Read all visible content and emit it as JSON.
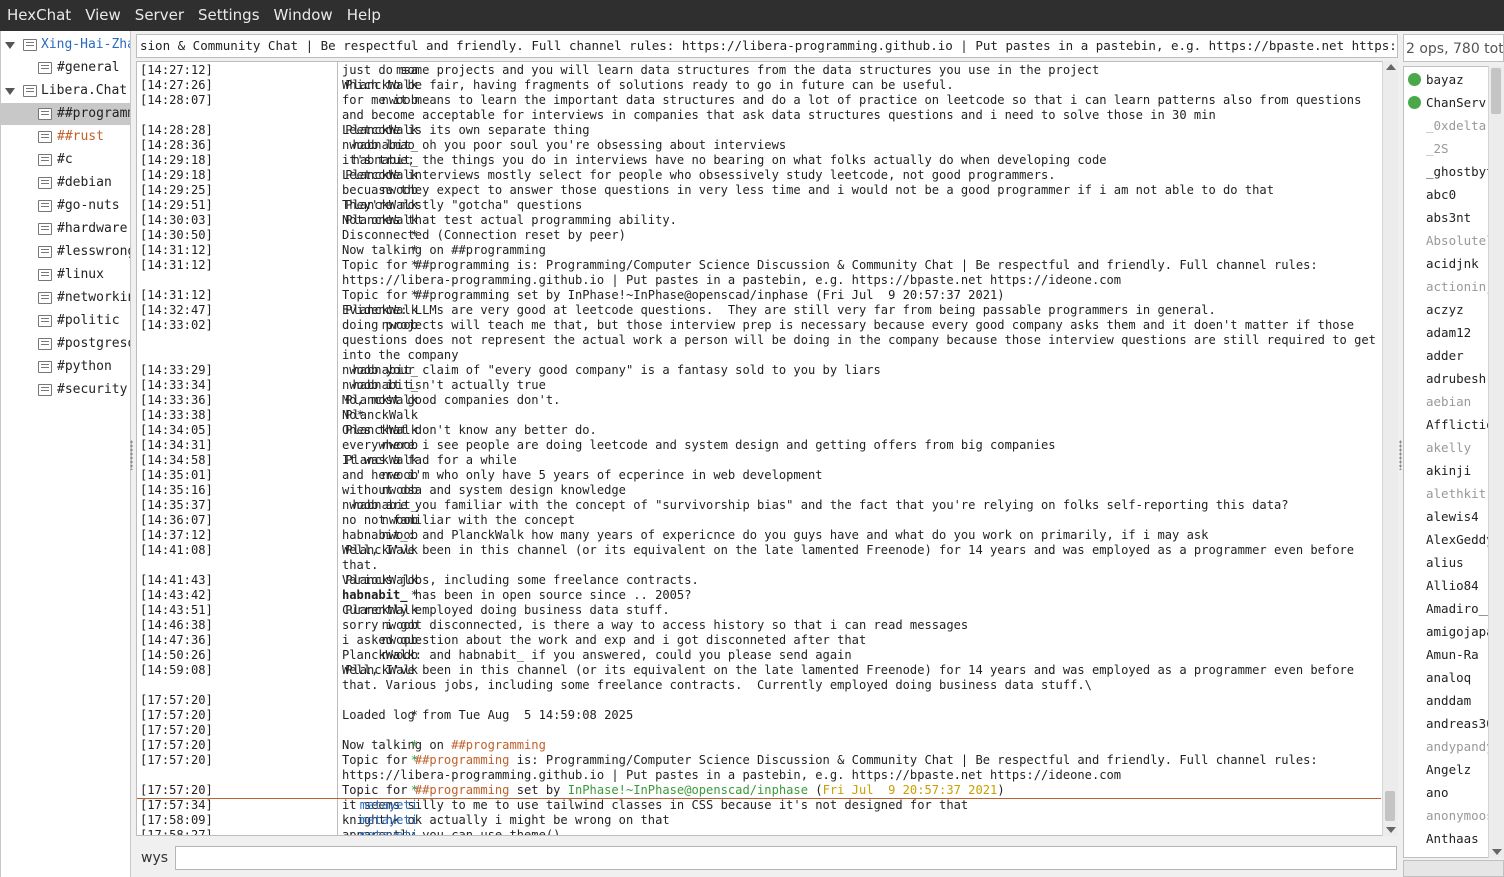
{
  "menu": [
    "HexChat",
    "View",
    "Server",
    "Settings",
    "Window",
    "Help"
  ],
  "tree": [
    {
      "type": "network",
      "label": "Xing-Hai-Zhar",
      "color": "#2a6abf"
    },
    {
      "type": "chan",
      "label": "#general",
      "color": "#222"
    },
    {
      "type": "network",
      "label": "Libera.Chat",
      "color": "#222"
    },
    {
      "type": "chan",
      "label": "##programm",
      "color": "#222",
      "selected": true
    },
    {
      "type": "chan",
      "label": "##rust",
      "color": "#c0602a"
    },
    {
      "type": "chan",
      "label": "#c",
      "color": "#222"
    },
    {
      "type": "chan",
      "label": "#debian",
      "color": "#222"
    },
    {
      "type": "chan",
      "label": "#go-nuts",
      "color": "#222"
    },
    {
      "type": "chan",
      "label": "#hardware",
      "color": "#222"
    },
    {
      "type": "chan",
      "label": "#lesswrong",
      "color": "#222"
    },
    {
      "type": "chan",
      "label": "#linux",
      "color": "#222"
    },
    {
      "type": "chan",
      "label": "#networkin",
      "color": "#222"
    },
    {
      "type": "chan",
      "label": "#politic",
      "color": "#222"
    },
    {
      "type": "chan",
      "label": "#postgresq",
      "color": "#222"
    },
    {
      "type": "chan",
      "label": "#python",
      "color": "#222"
    },
    {
      "type": "chan",
      "label": "#security",
      "color": "#222"
    }
  ],
  "topic": "sion & Community Chat | Be respectful and friendly. Full channel rules: https://libera-programming.github.io | Put pastes in a pastebin, e.g. https://bpaste.net https://ideone.com",
  "messages": [
    {
      "ts": "[14:27:12]",
      "nick": "msa",
      "msg": "just do some projects and you will learn data structures from the data structures you use in the project"
    },
    {
      "ts": "[14:27:26]",
      "nick": "PlanckWalk",
      "msg": "Which to be fair, having fragments of solutions ready to go in future can be useful."
    },
    {
      "ts": "[14:28:07]",
      "nick": "nwoob",
      "msg": "for me it means to learn the important data structures and do a lot of practice on leetcode so that i can learn patterns also from questions and become acceptable for interviews in companies that ask data structures questions and i need to solve those in 30 min"
    },
    {
      "ts": "[14:28:28]",
      "nick": "PlanckWalk",
      "msg": "Leetcode is its own separate thing"
    },
    {
      "ts": "[14:28:36]",
      "nick": "habnabit_",
      "msg": "nwoob lmao oh you poor soul you're obsessing about interviews"
    },
    {
      "ts": "[14:29:18]",
      "nick": "habnabit_",
      "msg": "it's true; the things you do in interviews have no bearing on what folks actually do when developing code"
    },
    {
      "ts": "[14:29:18]",
      "nick": "PlanckWalk",
      "msg": "Leetcode interviews mostly select for people who obsessively study leetcode, not good programmers."
    },
    {
      "ts": "[14:29:25]",
      "nick": "nwoob",
      "msg": "becuase they expect to answer those questions in very less time and i would not be a good programmer if i am not able to do that"
    },
    {
      "ts": "[14:29:51]",
      "nick": "PlanckWalk",
      "msg": "They're mostly \"gotcha\" questions"
    },
    {
      "ts": "[14:30:03]",
      "nick": "PlanckWalk",
      "msg": "Not ones that test actual programming ability."
    },
    {
      "ts": "[14:30:50]",
      "nick": "*",
      "msg": "Disconnected (Connection reset by peer)"
    },
    {
      "ts": "[14:31:12]",
      "nick": "*",
      "msg": "Now talking on ##programming"
    },
    {
      "ts": "[14:31:12]",
      "nick": "*",
      "msg": "Topic for ##programming is: Programming/Computer Science Discussion & Community Chat | Be respectful and friendly. Full channel rules: https://libera-programming.github.io | Put pastes in a pastebin, e.g. https://bpaste.net https://ideone.com"
    },
    {
      "ts": "[14:31:12]",
      "nick": "*",
      "msg": "Topic for ##programming set by InPhase!~InPhase@openscad/inphase (Fri Jul  9 20:57:37 2021)"
    },
    {
      "ts": "[14:32:47]",
      "nick": "PlanckWalk",
      "msg": "Evidence: LLMs are very good at leetcode questions.  They are still very far from being passable programmers in general."
    },
    {
      "ts": "[14:33:02]",
      "nick": "nwoob",
      "msg": "doing projects will teach me that, but those interview prep is necessary because every good company asks them and it doen't matter if those questions does not represent the actual work a person will be doing in the company because those interview questions are still required to get into the company"
    },
    {
      "ts": "[14:33:29]",
      "nick": "habnabit_",
      "msg": "nwoob your claim of \"every good company\" is a fantasy sold to you by liars"
    },
    {
      "ts": "[14:33:34]",
      "nick": "habnabit_",
      "msg": "nwoob it isn't actually true"
    },
    {
      "ts": "[14:33:36]",
      "nick": "PlanckWalk",
      "msg": "Mo, most good companies don't."
    },
    {
      "ts": "[14:33:38]",
      "nick": "PlanckWalk",
      "msg": "No*"
    },
    {
      "ts": "[14:34:05]",
      "nick": "PlanckWalk",
      "msg": "Ones that don't know any better do."
    },
    {
      "ts": "[14:34:31]",
      "nick": "nwoob",
      "msg": "everywhere i see people are doing leetcode and system design and getting offers from big companies"
    },
    {
      "ts": "[14:34:58]",
      "nick": "PlanckWalk",
      "msg": "It was a fad for a while"
    },
    {
      "ts": "[14:35:01]",
      "nick": "nwoob",
      "msg": "and here i'm who only have 5 years of ecperince in web development"
    },
    {
      "ts": "[14:35:16]",
      "nick": "nwoob",
      "msg": "without dsa and system design knowledge"
    },
    {
      "ts": "[14:35:37]",
      "nick": "habnabit_",
      "msg": "nwoob are you familiar with the concept of \"survivorship bias\" and the fact that you're relying on folks self-reporting this data?"
    },
    {
      "ts": "[14:36:07]",
      "nick": "nwoob",
      "msg": "no not familiar with the concept"
    },
    {
      "ts": "[14:37:12]",
      "nick": "nwoob",
      "msg": "habnabit_: and PlanckWalk how many years of expericnce do you guys have and what do you work on primarily, if i may ask"
    },
    {
      "ts": "[14:41:08]",
      "nick": "PlanckWalk",
      "msg": "Well, I've been in this channel (or its equivalent on the late lamented Freenode) for 14 years and was employed as a programmer even before that."
    },
    {
      "ts": "[14:41:43]",
      "nick": "PlanckWalk",
      "msg": "Various jobs, including some freelance contracts."
    },
    {
      "ts": "[14:43:42]",
      "nick": "*",
      "msg_bold": "habnabit_",
      "msg": " has been in open source since .. 2005?"
    },
    {
      "ts": "[14:43:51]",
      "nick": "PlanckWalk",
      "msg": "Currently employed doing business data stuff."
    },
    {
      "ts": "[14:46:38]",
      "nick": "nwoob",
      "msg": "sorry i got disconnected, is there a way to access history so that i can read messages"
    },
    {
      "ts": "[14:47:36]",
      "nick": "nwoob",
      "msg": "i asked question about the work and exp and i got disconneted after that"
    },
    {
      "ts": "[14:50:26]",
      "nick": "nwoob",
      "msg": "PlanckWalk: and habnabit_ if you answered, could you please send again"
    },
    {
      "ts": "[14:59:08]",
      "nick": "PlanckWalk",
      "msg": "Well, I've been in this channel (or its equivalent on the late lamented Freenode) for 14 years and was employed as a programmer even before that. Various jobs, including some freelance contracts.  Currently employed doing business data stuff.\\"
    },
    {
      "ts": "[17:57:20]",
      "nick": "",
      "msg": ""
    },
    {
      "ts": "[17:57:20]",
      "nick": "*",
      "msg": "Loaded log from Tue Aug  5 14:59:08 2025"
    },
    {
      "ts": "[17:57:20]",
      "nick": "",
      "msg": ""
    },
    {
      "ts": "[17:57:20]",
      "nick": "*",
      "nick_color": "green",
      "msg_pre": "Now talking on ",
      "msg_chan": "##programming",
      "msg": ""
    },
    {
      "ts": "[17:57:20]",
      "nick": "*",
      "nick_color": "green",
      "msg_pre": "Topic for ",
      "msg_chan": "##programming",
      "msg": " is: Programming/Computer Science Discussion & Community Chat | Be respectful and friendly. Full channel rules: https://libera-programming.github.io | Put pastes in a pastebin, e.g. https://bpaste.net https://ideone.com"
    },
    {
      "ts": "[17:57:20]",
      "nick": "*",
      "nick_color": "green",
      "msg_pre": "Topic for ",
      "msg_chan": "##programming",
      "msg_mid": " set by ",
      "msg_user": "InPhase!~InPhase@openscad/inphase",
      "msg_post": " (",
      "msg_date": "Fri Jul  9 20:57:37 2021",
      "msg": ")"
    },
    {
      "ts": "[17:57:34]",
      "nick": "metayeti",
      "nick_color": "blue",
      "msg": "it seems silly to me to use tailwind classes in CSS because it's not designed for that"
    },
    {
      "ts": "[17:58:09]",
      "nick": "metayeti",
      "nick_color": "blue",
      "msg": "knighthk ok actually i might be wrong on that"
    },
    {
      "ts": "[17:58:27]",
      "nick": "metayeti",
      "nick_color": "blue",
      "msg": "apparently you can use theme()"
    }
  ],
  "input": {
    "nick": "wys",
    "value": ""
  },
  "user_count": "2 ops, 780 tota",
  "users": [
    {
      "name": "bayaz",
      "op": true
    },
    {
      "name": "ChanServ",
      "op": true
    },
    {
      "name": "_0xdelta",
      "away": true
    },
    {
      "name": "_2S",
      "away": true
    },
    {
      "name": "_ghostbyt"
    },
    {
      "name": "abc0"
    },
    {
      "name": "abs3nt"
    },
    {
      "name": "Absolutel",
      "away": true
    },
    {
      "name": "acidjnk"
    },
    {
      "name": "actioninj",
      "away": true
    },
    {
      "name": "aczyz"
    },
    {
      "name": "adam12"
    },
    {
      "name": "adder"
    },
    {
      "name": "adrubesh"
    },
    {
      "name": "aebian",
      "away": true
    },
    {
      "name": "Afflictio"
    },
    {
      "name": "akelly",
      "away": true
    },
    {
      "name": "akinji"
    },
    {
      "name": "alethkit",
      "away": true
    },
    {
      "name": "alewis4"
    },
    {
      "name": "AlexGeddy"
    },
    {
      "name": "alius"
    },
    {
      "name": "Allio84"
    },
    {
      "name": "Amadiro__"
    },
    {
      "name": "amigojapa"
    },
    {
      "name": "Amun-Ra"
    },
    {
      "name": "analoq"
    },
    {
      "name": "anddam"
    },
    {
      "name": "andreas30"
    },
    {
      "name": "andypandy",
      "away": true
    },
    {
      "name": "Angelz"
    },
    {
      "name": "ano"
    },
    {
      "name": "anonymoos",
      "away": true
    },
    {
      "name": "Anthaas"
    }
  ]
}
